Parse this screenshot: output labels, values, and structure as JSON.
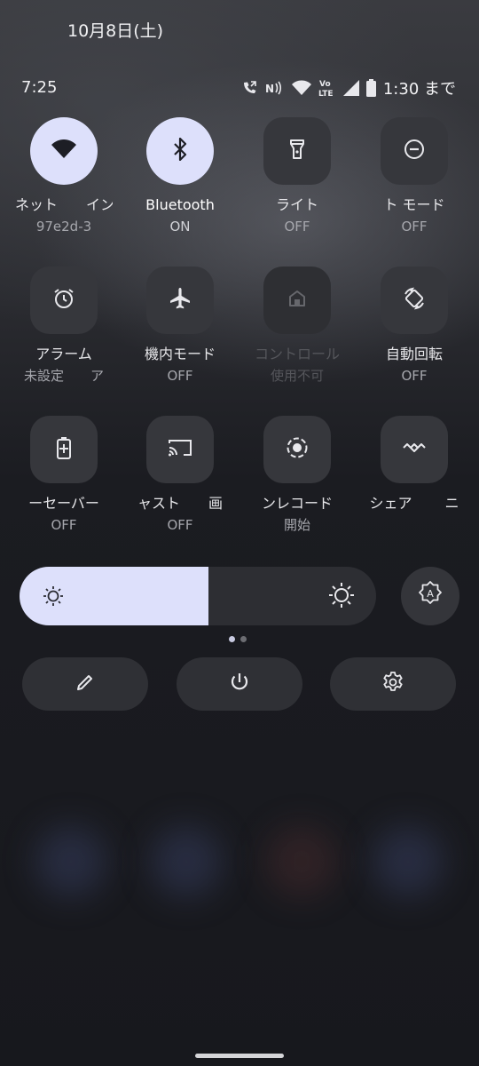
{
  "header": {
    "date": "10月8日(土)",
    "time": "7:25"
  },
  "status_bar": {
    "icons": [
      "call-forward-icon",
      "nfc-icon",
      "wifi-icon",
      "volte-icon",
      "signal-icon",
      "battery-icon"
    ],
    "volte_text": "Vo LTE",
    "battery_text": "1:30 まで"
  },
  "tiles": [
    {
      "id": "internet",
      "icon": "wifi-icon",
      "label": "ネット　　イン",
      "sub": "97e2d-3　　",
      "state": "on"
    },
    {
      "id": "bluetooth",
      "icon": "bluetooth-icon",
      "label": "Bluetooth",
      "sub": "ON",
      "state": "on"
    },
    {
      "id": "flashlight",
      "icon": "flashlight-icon",
      "label": "ライト",
      "sub": "OFF",
      "state": "off"
    },
    {
      "id": "dnd",
      "icon": "do-not-disturb-icon",
      "label": "ト モード",
      "sub": "OFF",
      "state": "off"
    },
    {
      "id": "alarm",
      "icon": "alarm-icon",
      "label": "アラーム",
      "sub": "未設定　　ア",
      "state": "off"
    },
    {
      "id": "airplane",
      "icon": "airplane-icon",
      "label": "機内モード",
      "sub": "OFF",
      "state": "off"
    },
    {
      "id": "home-control",
      "icon": "home-icon",
      "label": "コントロール",
      "sub": "使用不可",
      "state": "disabled"
    },
    {
      "id": "auto-rotate",
      "icon": "rotate-icon",
      "label": "自動回転",
      "sub": "OFF",
      "state": "off"
    },
    {
      "id": "battery-saver",
      "icon": "battery-saver-icon",
      "label": "ーセーバー",
      "sub": "OFF",
      "state": "off"
    },
    {
      "id": "cast",
      "icon": "cast-icon",
      "label": "ャスト　　画",
      "sub": "OFF",
      "state": "off"
    },
    {
      "id": "screen-record",
      "icon": "screen-record-icon",
      "label": "ンレコード",
      "sub": "開始",
      "state": "off"
    },
    {
      "id": "nearby-share",
      "icon": "nearby-share-icon",
      "label": "シェア　　 ニ",
      "sub": "",
      "state": "off"
    }
  ],
  "brightness": {
    "level": 0.53
  },
  "page_indicator": {
    "count": 2,
    "active": 0
  },
  "bottom_actions": [
    {
      "id": "edit",
      "icon": "pencil-icon"
    },
    {
      "id": "power",
      "icon": "power-icon"
    },
    {
      "id": "settings",
      "icon": "gear-icon"
    }
  ],
  "colors": {
    "active_tile": "#dde0fb",
    "inactive_tile": "#36373c",
    "background": "#1c1d22"
  }
}
